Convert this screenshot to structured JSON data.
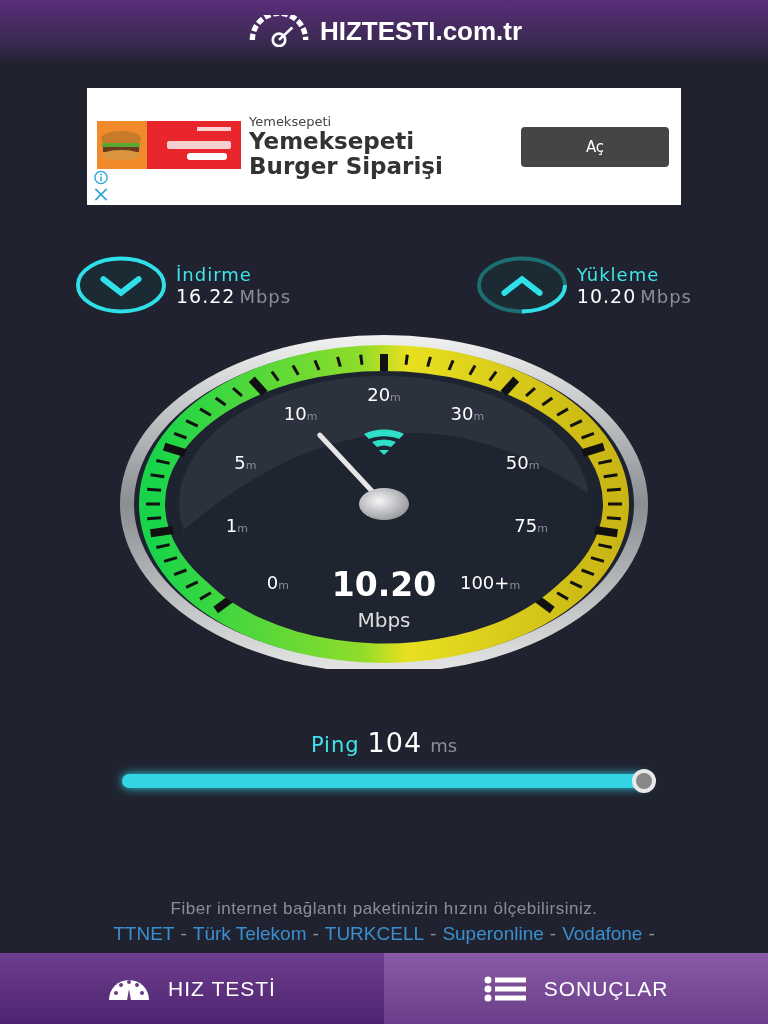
{
  "header": {
    "title": "HIZTESTI.com.tr"
  },
  "ad": {
    "advertiser": "Yemeksepeti",
    "headline": "Yemeksepeti Burger Siparişi",
    "button": "Aç"
  },
  "stats": [
    {
      "kind": "download",
      "label": "İndirme",
      "value": "16.22",
      "unit": "Mbps"
    },
    {
      "kind": "upload",
      "label": "Yükleme",
      "value": "10.20",
      "unit": "Mbps"
    }
  ],
  "gauge": {
    "value": "10.20",
    "unit": "Mbps",
    "labels": [
      {
        "value": "0",
        "unit": "m"
      },
      {
        "value": "1",
        "unit": "m"
      },
      {
        "value": "5",
        "unit": "m"
      },
      {
        "value": "10",
        "unit": "m"
      },
      {
        "value": "20",
        "unit": "m"
      },
      {
        "value": "30",
        "unit": "m"
      },
      {
        "value": "50",
        "unit": "m"
      },
      {
        "value": "75",
        "unit": "m"
      },
      {
        "value": "100+",
        "unit": "m"
      }
    ]
  },
  "ping": {
    "label": "Ping",
    "value": "104",
    "unit": "ms",
    "level": 1.0
  },
  "footer": {
    "text": "Fiber internet bağlantı paketinizin hızını ölçebilirsiniz.",
    "separator": "-",
    "providers": [
      "TTNET",
      "Türk Telekom",
      "TURKCELL",
      "Superonline",
      "Vodafone"
    ]
  },
  "nav": [
    {
      "kind": "speed",
      "label": "HIZ TESTİ",
      "selected": true
    },
    {
      "kind": "results",
      "label": "SONUÇLAR",
      "selected": false
    }
  ]
}
